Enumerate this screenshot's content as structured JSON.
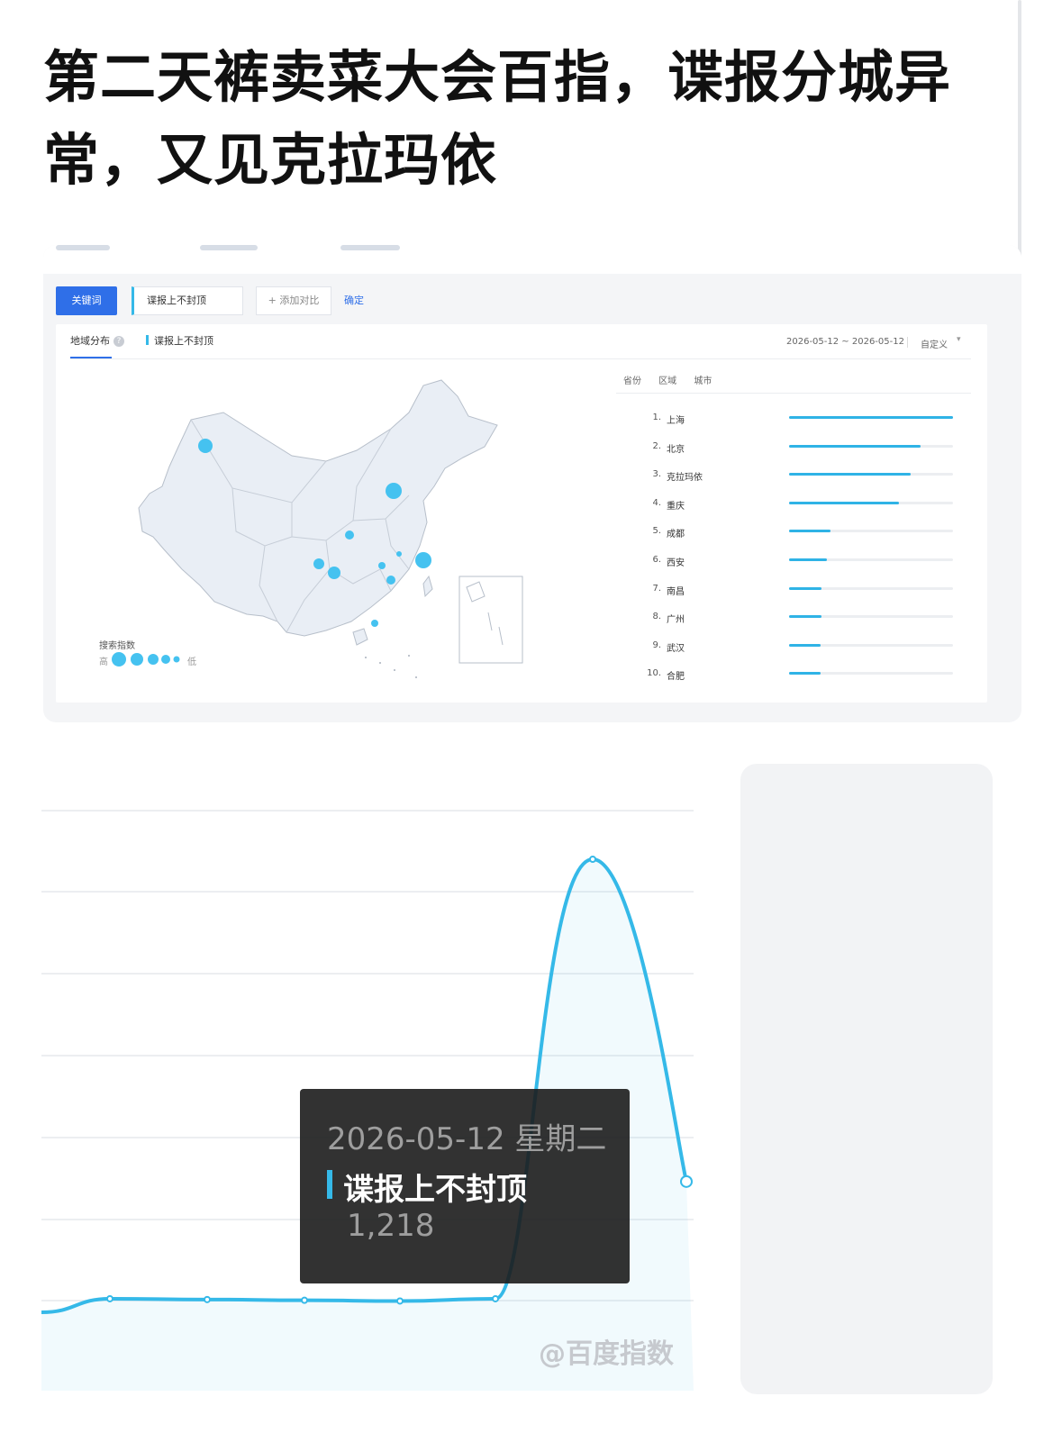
{
  "headline": "第二天裤卖菜大会百指，谍报分城异常，又见克拉玛依",
  "region_panel": {
    "keyword_button": "关键词",
    "keyword_input": "谍报上不封顶",
    "add_compare": "+ 添加对比",
    "confirm": "确定",
    "tab_active": "地域分布",
    "legend_keyword": "谍报上不封顶",
    "date_range": "2026-05-12 ~ 2026-05-12",
    "custom_label": "自定义",
    "scale_title": "搜索指数",
    "scale_high": "高",
    "scale_low": "低",
    "rank_tabs": [
      "省份",
      "区域",
      "城市"
    ],
    "rankings": [
      {
        "rank": "1.",
        "city": "上海",
        "share": 1.0
      },
      {
        "rank": "2.",
        "city": "北京",
        "share": 0.8
      },
      {
        "rank": "3.",
        "city": "克拉玛依",
        "share": 0.74
      },
      {
        "rank": "4.",
        "city": "重庆",
        "share": 0.67
      },
      {
        "rank": "5.",
        "city": "成都",
        "share": 0.25
      },
      {
        "rank": "6.",
        "city": "西安",
        "share": 0.23
      },
      {
        "rank": "7.",
        "city": "南昌",
        "share": 0.2
      },
      {
        "rank": "8.",
        "city": "广州",
        "share": 0.2
      },
      {
        "rank": "9.",
        "city": "武汉",
        "share": 0.19
      },
      {
        "rank": "10.",
        "city": "合肥",
        "share": 0.19
      }
    ],
    "bar_color": "#2fb3e6",
    "accent_color": "#2f6fe8"
  },
  "trend": {
    "tooltip_date": "2026-05-12 星期二",
    "tooltip_series": "谍报上不封顶",
    "tooltip_value": "1,218",
    "watermark": "@百度指数",
    "line_color": "#35b9e8"
  },
  "chart_data": {
    "type": "area",
    "series": [
      {
        "name": "谍报上不封顶",
        "values": [
          12,
          48,
          46,
          44,
          42,
          48,
          1218,
          360
        ]
      }
    ],
    "peak_value": 1218,
    "grid": true
  }
}
